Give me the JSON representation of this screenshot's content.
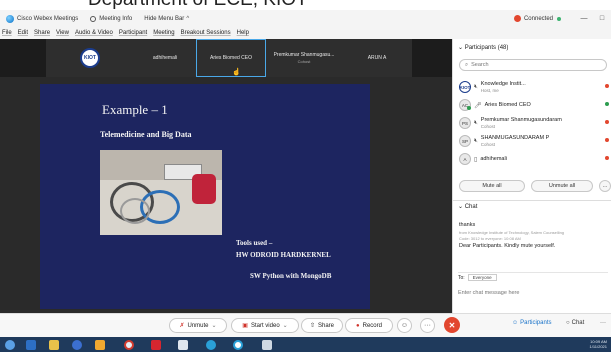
{
  "overlay_text": "Department of ECE, KIOT",
  "window": {
    "app_title": "Cisco Webex Meetings",
    "meeting_info": "Meeting Info",
    "hide_menu_bar": "Hide Menu Bar",
    "connected": "Connected",
    "minimize": "—",
    "restore": "□"
  },
  "menu": [
    "File",
    "Edit",
    "Share",
    "View",
    "Audio & Video",
    "Participant",
    "Meeting",
    "Breakout Sessions",
    "Help"
  ],
  "video_strip": {
    "logo_text": "KIOT",
    "tiles": [
      {
        "name": "adhihemali",
        "sub": ""
      },
      {
        "name": "Aries Biomed CEO",
        "sub": ""
      },
      {
        "name": "Premkumar Shanmugasu...",
        "sub": "Cohost"
      },
      {
        "name": "ARUN A",
        "sub": ""
      }
    ]
  },
  "slide": {
    "title": "Example – 1",
    "subtitle": "Telemedicine and Big Data",
    "tools_label": "Tools used –",
    "hw_line": "HW  ODROID HARDKERNEL",
    "sw_line": "SW  Python with MongoDB"
  },
  "controls": {
    "unmute": "Unmute",
    "start_video": "Start video",
    "share": "Share",
    "record": "Record",
    "more": "···",
    "participants": "Participants",
    "chat": "Chat",
    "panel_more": "···"
  },
  "participants_panel": {
    "header": "Participants (48)",
    "search_placeholder": "Search",
    "list": [
      {
        "initials": "KIOT",
        "name": "Knowledge Instit...",
        "role": "Host, me",
        "logo": true,
        "status": "red"
      },
      {
        "initials": "AC",
        "name": "Aries Biomed CEO",
        "role": "",
        "logo": false,
        "status": "green"
      },
      {
        "initials": "PS",
        "name": "Premkumar Shanmugasundaram",
        "role": "Cohost",
        "logo": false,
        "status": "red"
      },
      {
        "initials": "SP",
        "name": "SHANMUGASUNDARAM P",
        "role": "Cohost",
        "logo": false,
        "status": "red"
      },
      {
        "initials": "A",
        "name": "adhihemali",
        "role": "",
        "logo": false,
        "status": "red"
      }
    ],
    "mute_all": "Mute all",
    "unmute_all": "Unmute all"
  },
  "chat_panel": {
    "header": "Chat",
    "messages": [
      {
        "type": "body",
        "text": "thanks"
      },
      {
        "type": "meta",
        "text": "from Knowledge Institute of Technology, Salem Counselling"
      },
      {
        "type": "meta",
        "text": "Code: 3012 to everyone:  10:08 AM"
      },
      {
        "type": "body",
        "text": "Dear Participants. Kindly mute yourself."
      }
    ],
    "to_label": "To:",
    "to_value": "Everyone",
    "input_placeholder": "Enter chat message here"
  },
  "taskbar": {
    "clock_time": "10:09 AM",
    "clock_date": "1/11/2021"
  },
  "colors": {
    "accent_red": "#e2472f",
    "slide_bg": "#1d2560",
    "tile_active_border": "#4aa8e8",
    "taskbar": "#1f3a5c"
  }
}
